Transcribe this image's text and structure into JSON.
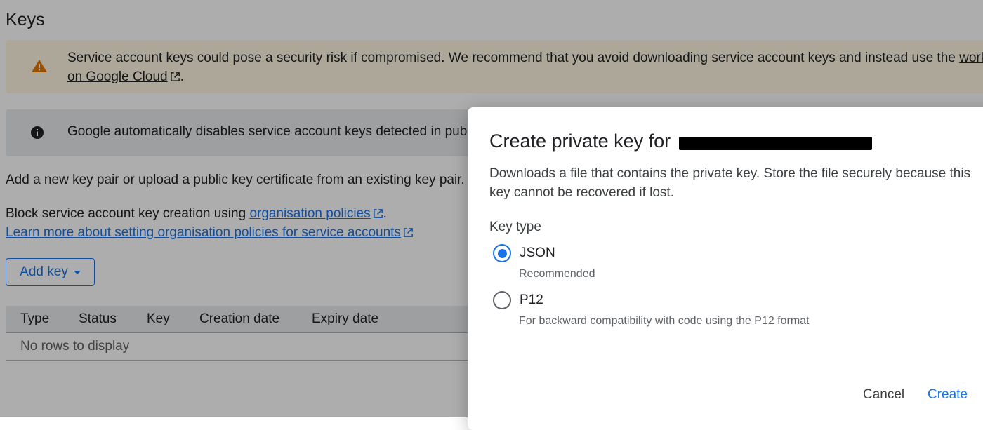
{
  "page": {
    "title": "Keys",
    "warning_banner": {
      "text": "Service account keys could pose a security risk if compromised. We recommend that you avoid downloading service account keys and instead use the ",
      "link": "workloa",
      "link2": "on Google Cloud",
      "suffix": "."
    },
    "info_banner": {
      "text": "Google automatically disables service account keys detected in publi"
    },
    "intro": "Add a new key pair or upload a public key certificate from an existing key pair.",
    "policy_line": {
      "prefix": "Block service account key creation using ",
      "link": "organisation policies",
      "suffix": "."
    },
    "learn_more_link": "Learn more about setting organisation policies for service accounts",
    "add_key_label": "Add key",
    "table": {
      "columns": [
        "Type",
        "Status",
        "Key",
        "Creation date",
        "Expiry date"
      ],
      "empty_text": "No rows to display"
    }
  },
  "dialog": {
    "title_prefix": "Create private key for ",
    "description": "Downloads a file that contains the private key. Store the file securely because this key cannot be recovered if lost.",
    "key_type_label": "Key type",
    "options": [
      {
        "label": "JSON",
        "sublabel": "Recommended",
        "selected": true
      },
      {
        "label": "P12",
        "sublabel": "For backward compatibility with code using the P12 format",
        "selected": false
      }
    ],
    "cancel_label": "Cancel",
    "create_label": "Create"
  },
  "colors": {
    "accent": "#1a73e8",
    "warning_bg": "#fef7e0",
    "warning_icon": "#e37400",
    "info_bg": "#e8eaed"
  },
  "icons": [
    "warning-icon",
    "info-icon",
    "external-link-icon",
    "dropdown-caret-icon"
  ]
}
